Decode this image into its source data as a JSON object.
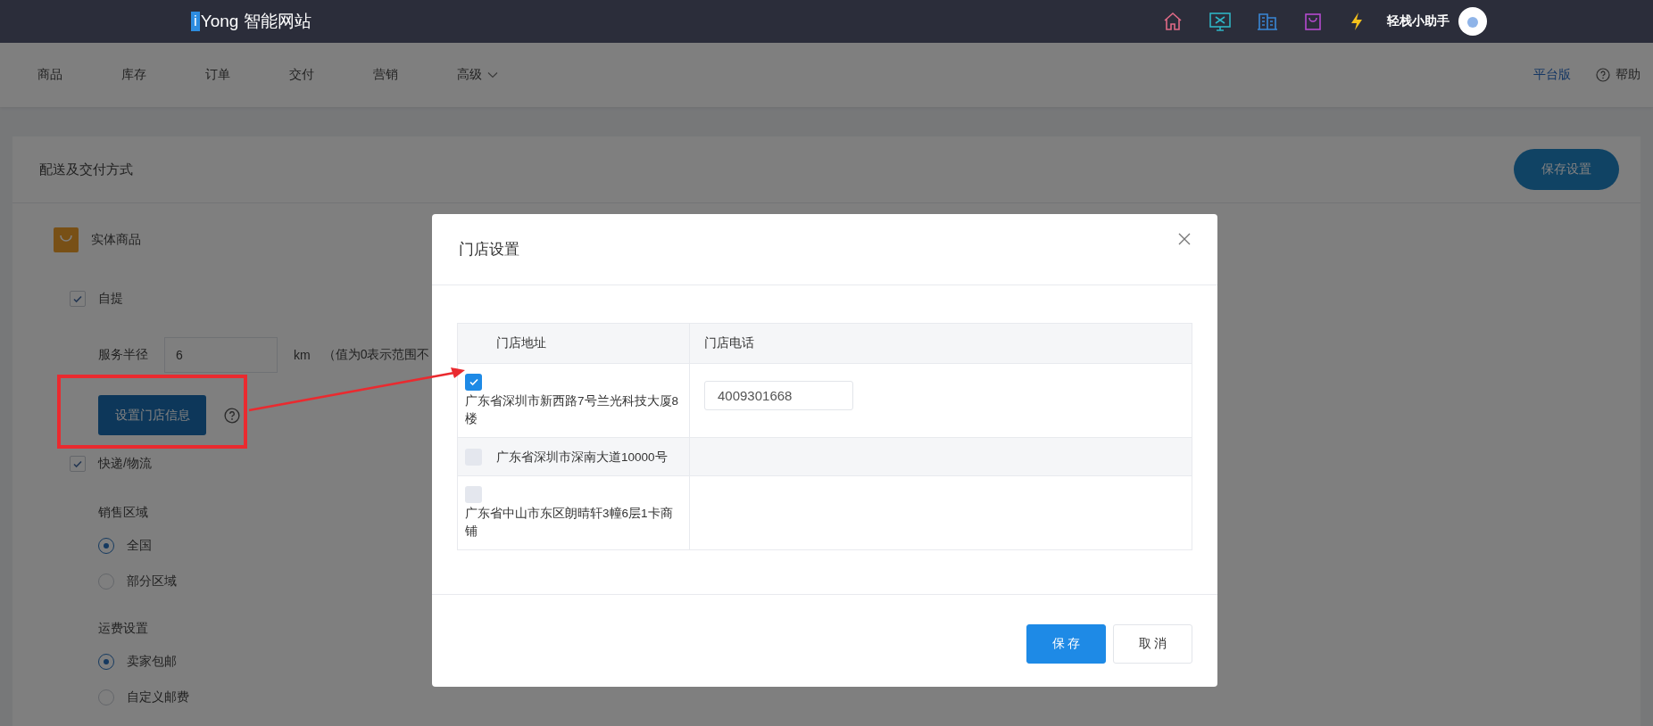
{
  "top_bar": {
    "logo_mark": "i",
    "logo_text": "Yong 智能网站",
    "assistant": "轻栈小助手"
  },
  "nav": {
    "items": [
      {
        "label": "商品",
        "kind": "link"
      },
      {
        "label": "库存",
        "kind": "link"
      },
      {
        "label": "订单",
        "kind": "link"
      },
      {
        "label": "交付",
        "kind": "link"
      },
      {
        "label": "营销",
        "kind": "link"
      },
      {
        "label": "高级",
        "kind": "dropdown"
      }
    ],
    "platform_link": "平台版",
    "help": "帮助"
  },
  "panel": {
    "title": "配送及交付方式",
    "save_button": "保存设置",
    "goods_type": "实体商品",
    "pickup": {
      "label": "自提",
      "checked": true,
      "radius_label": "服务半径",
      "radius_value": "6",
      "unit": "km",
      "note": "（值为0表示范围不",
      "store_button": "设置门店信息"
    },
    "express": {
      "label": "快递/物流",
      "checked": true
    },
    "sales_area": {
      "title": "销售区域",
      "options": [
        {
          "label": "全国",
          "selected": true
        },
        {
          "label": "部分区域",
          "selected": false
        }
      ]
    },
    "shipping_fee": {
      "title": "运费设置",
      "options": [
        {
          "label": "卖家包邮",
          "selected": true
        },
        {
          "label": "自定义邮费",
          "selected": false
        }
      ]
    }
  },
  "dialog": {
    "title": "门店设置",
    "table": {
      "columns": [
        "门店地址",
        "门店电话"
      ],
      "rows": [
        {
          "address": "广东省深圳市新西路7号兰光科技大厦8楼",
          "checked": true,
          "phone": "4009301668"
        },
        {
          "address": "广东省深圳市深南大道10000号",
          "checked": false
        },
        {
          "address": "广东省中山市东区朗晴轩3幢6层1卡商铺",
          "checked": false
        }
      ]
    },
    "buttons": [
      {
        "label": "保 存",
        "kind": "primary"
      },
      {
        "label": "取 消",
        "kind": "default"
      }
    ]
  }
}
